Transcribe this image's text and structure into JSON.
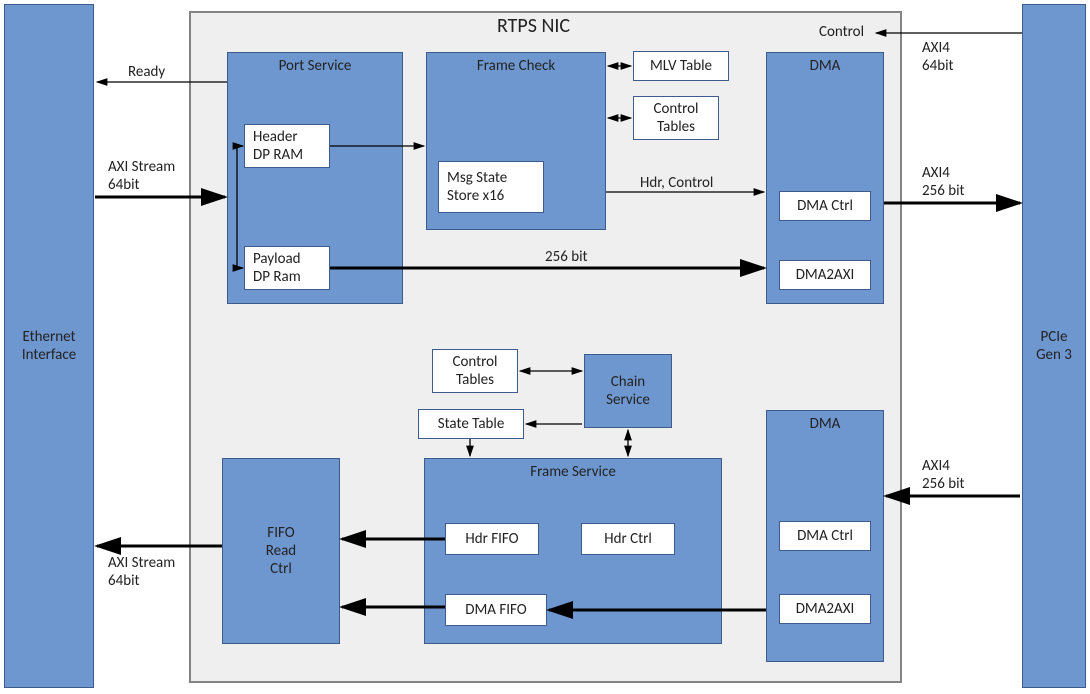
{
  "title": "RTPS NIC",
  "left_if": "Ethernet\nInterface",
  "right_if": "PCIe\nGen 3",
  "blocks": {
    "port_service": "Port Service",
    "header_dpram": "Header\nDP RAM",
    "payload_dpram": "Payload\nDP Ram",
    "frame_check": "Frame Check",
    "msg_state": "Msg State\nStore x16",
    "mlv_table": "MLV Table",
    "control_tables_top": "Control\nTables",
    "dma_top": "DMA",
    "dma_ctrl_top": "DMA Ctrl",
    "dma2axi_top": "DMA2AXI",
    "control_tables_bot": "Control\nTables",
    "chain_service": "Chain\nService",
    "state_table": "State Table",
    "frame_service": "Frame Service",
    "hdr_fifo": "Hdr FIFO",
    "hdr_ctrl": "Hdr Ctrl",
    "dma_fifo": "DMA FIFO",
    "fifo_read": "FIFO\nRead\nCtrl",
    "dma_bot": "DMA",
    "dma_ctrl_bot": "DMA Ctrl",
    "dma2axi_bot": "DMA2AXI"
  },
  "labels": {
    "ready": "Ready",
    "axi_in": "AXI Stream\n64bit",
    "axi_out": "AXI Stream\n64bit",
    "control": "Control",
    "axi4_64": "AXI4\n64bit",
    "axi4_256_top": "AXI4\n256 bit",
    "axi4_256_bot": "AXI4\n256 bit",
    "hdr_control": "Hdr, Control",
    "w256": "256 bit"
  }
}
